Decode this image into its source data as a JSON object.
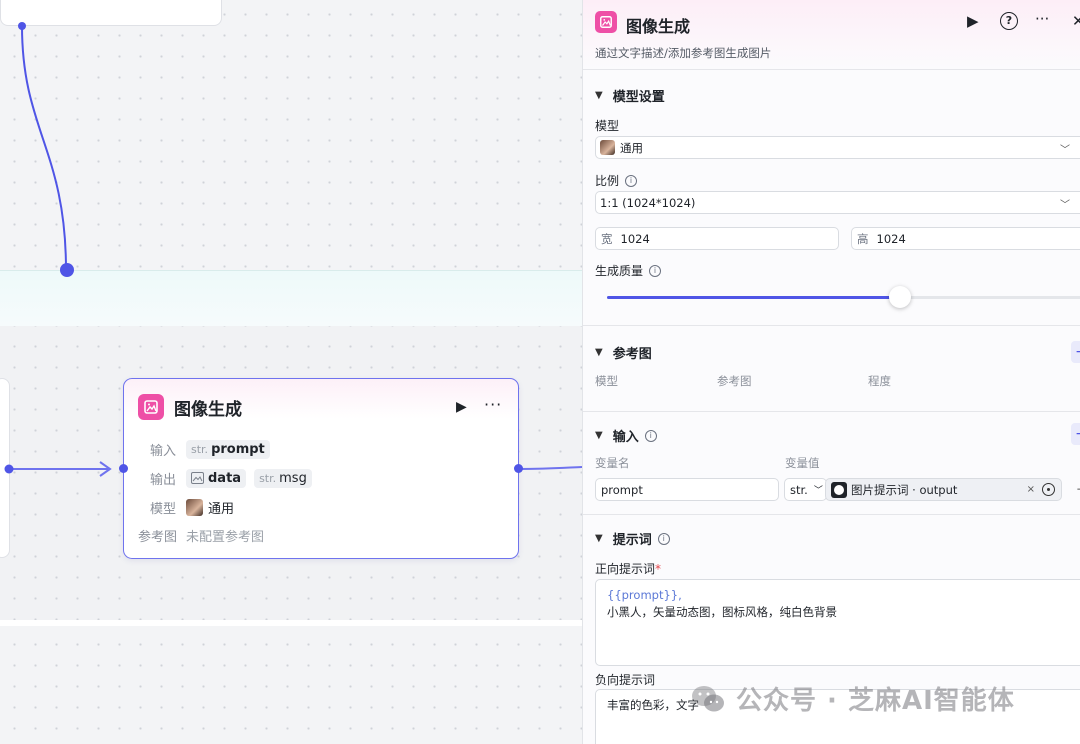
{
  "canvas": {
    "node": {
      "title": "图像生成",
      "rows": {
        "input_label": "输入",
        "input_type": "str.",
        "input_name": "prompt",
        "output_label": "输出",
        "output_data": "data",
        "output_type": "str.",
        "output_msg": "msg",
        "model_label": "模型",
        "model_value": "通用",
        "ref_label": "参考图",
        "ref_value": "未配置参考图"
      }
    }
  },
  "panel": {
    "title": "图像生成",
    "description": "通过文字描述/添加参考图生成图片",
    "actions": {
      "run": "▶",
      "help": "?",
      "more": "···",
      "close": "✕"
    },
    "model_settings": {
      "section_title": "模型设置",
      "model_label": "模型",
      "model_value": "通用",
      "ratio_label": "比例",
      "ratio_value": "1:1 (1024*1024)",
      "width_prefix": "宽",
      "width_value": "1024",
      "height_prefix": "高",
      "height_value": "1024",
      "quality_label": "生成质量",
      "quality_level": 0.61
    },
    "reference": {
      "section_title": "参考图",
      "columns": [
        "模型",
        "参考图",
        "程度"
      ]
    },
    "input": {
      "section_title": "输入",
      "col_name": "变量名",
      "col_value": "变量值",
      "var_name": "prompt",
      "var_type": "str.",
      "var_ref": "图片提示词 · output"
    },
    "prompt": {
      "section_title": "提示词",
      "positive_label": "正向提示词",
      "required_mark": "*",
      "positive_var": "{{prompt}},",
      "positive_text": "小黑人，矢量动态图，图标风格，纯白色背景",
      "negative_label": "负向提示词",
      "negative_text": "丰富的色彩，文字"
    }
  },
  "watermark": {
    "text": "公众号 · 芝麻AI智能体"
  },
  "colors": {
    "accent": "#4f55e6",
    "app_icon": "#ee4fa6",
    "node_border": "#6f73ee"
  }
}
